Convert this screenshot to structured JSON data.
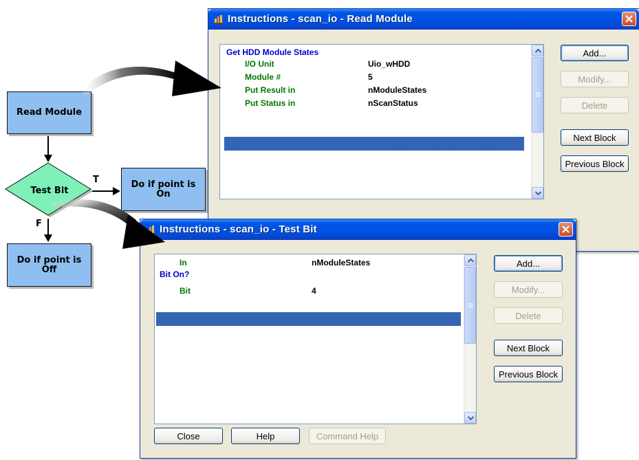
{
  "flowchart": {
    "read_module": "Read Module",
    "test_bit": "Test Bit",
    "do_if_on": "Do if point is On",
    "do_if_off": "Do if point is Off",
    "true_label": "T",
    "false_label": "F"
  },
  "read_dialog": {
    "title": "Instructions - scan_io - Read Module",
    "instruction_header": "Get HDD Module States",
    "params": [
      {
        "key": "I/O Unit",
        "value": "Uio_wHDD"
      },
      {
        "key": "Module #",
        "value": "5"
      },
      {
        "key": "Put Result in",
        "value": "nModuleStates"
      },
      {
        "key": "Put Status in",
        "value": "nScanStatus"
      }
    ],
    "buttons": {
      "add": "Add...",
      "modify": "Modify...",
      "delete": "Delete",
      "next_block": "Next Block",
      "previous_block": "Previous Block"
    }
  },
  "testbit_dialog": {
    "title": "Instructions - scan_io - Test Bit",
    "row_in": {
      "key": "In",
      "value": "nModuleStates"
    },
    "bit_on_header": "Bit On?",
    "row_bit": {
      "key": "Bit",
      "value": "4"
    },
    "buttons": {
      "add": "Add...",
      "modify": "Modify...",
      "delete": "Delete",
      "next_block": "Next Block",
      "previous_block": "Previous Block",
      "close": "Close",
      "help": "Help",
      "command_help": "Command Help"
    }
  },
  "colors": {
    "flow_box": "#8fbff0",
    "flow_diamond": "#7ff0b8",
    "header_blue": "#0000cc",
    "param_green": "#007700",
    "xp_titlebar": "#0055e5",
    "dialog_bg": "#ece9d8"
  },
  "icons": [
    "app-icon",
    "close-icon",
    "scroll-up-icon",
    "scroll-down-icon",
    "callout-arrow-icon"
  ]
}
